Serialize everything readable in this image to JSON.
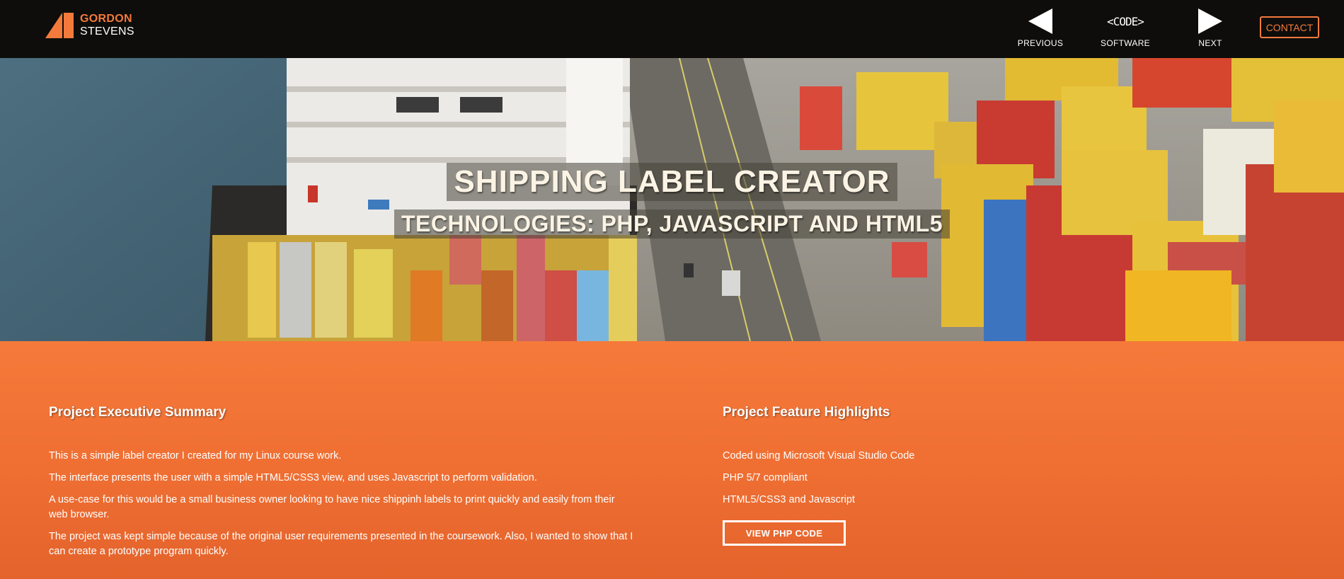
{
  "brand": {
    "name_line1": "GORDON",
    "name_line2": "STEVENS",
    "accent": "#f47a3c"
  },
  "nav": {
    "previous": {
      "label": "PREVIOUS",
      "icon": "arrow-left-icon"
    },
    "software": {
      "label": "SOFTWARE",
      "icon_text": "<CODE>"
    },
    "next": {
      "label": "NEXT",
      "icon": "arrow-right-icon"
    },
    "contact_label": "CONTACT"
  },
  "hero": {
    "title": "SHIPPING LABEL CREATOR",
    "subtitle": "TECHNOLOGIES: PHP, JAVASCRIPT AND HTML5"
  },
  "summary": {
    "heading": "Project Executive Summary",
    "paragraphs": [
      "This is a simple label creator I created for my Linux course work.",
      "The interface presents the user with a simple HTML5/CSS3 view, and uses Javascript to perform validation.",
      "A use-case for this would be a small business owner looking to have nice shippinh labels to print quickly and easily from their web browser.",
      "The project was kept simple because of the original user requirements presented in the coursework. Also, I wanted to show that I can create a prototype program quickly."
    ]
  },
  "features": {
    "heading": "Project Feature Highlights",
    "items": [
      "Coded using Microsoft Visual Studio Code",
      "PHP 5/7 compliant",
      "HTML5/CSS3 and Javascript"
    ],
    "button_label": "VIEW PHP CODE"
  }
}
